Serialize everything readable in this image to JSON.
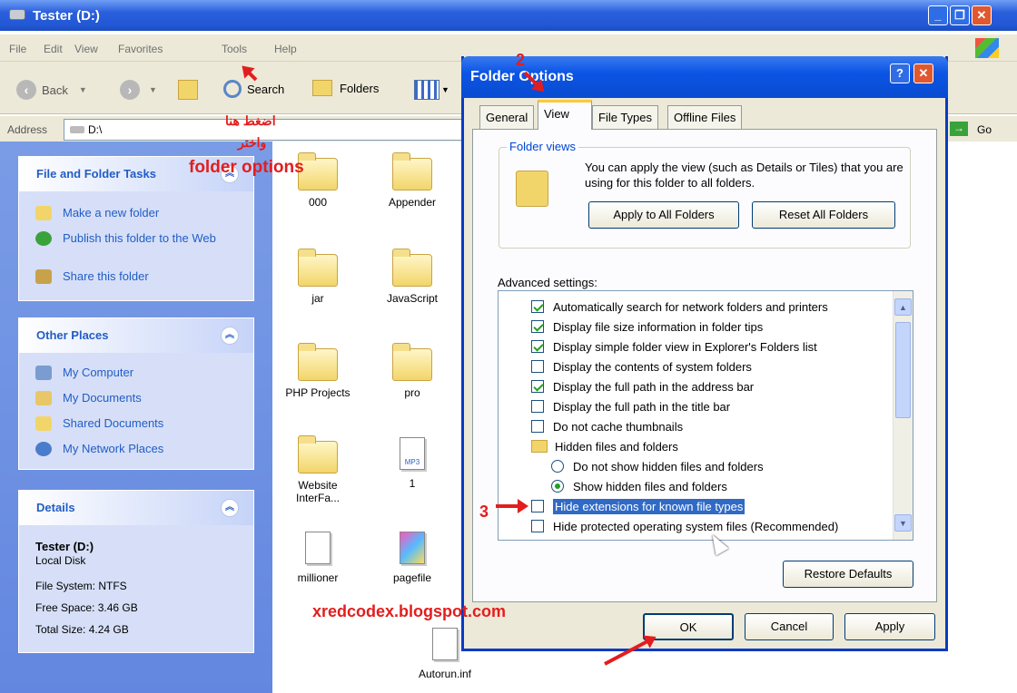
{
  "window": {
    "title": "Tester (D:)"
  },
  "menu": [
    "File",
    "Edit",
    "View",
    "Favorites",
    "Tools",
    "Help"
  ],
  "toolbar": {
    "back": "Back",
    "search": "Search",
    "folders": "Folders"
  },
  "address": {
    "label": "Address",
    "value": "D:\\",
    "go": "Go"
  },
  "tasks": {
    "title": "File and Folder Tasks",
    "items": [
      "Make a new folder",
      "Publish this folder to the Web",
      "Share this folder"
    ]
  },
  "places": {
    "title": "Other Places",
    "items": [
      "My Computer",
      "My Documents",
      "Shared Documents",
      "My Network Places"
    ]
  },
  "details": {
    "title": "Details",
    "name": "Tester (D:)",
    "type": "Local Disk",
    "fs": "File System: NTFS",
    "free": "Free Space: 3.46 GB",
    "total": "Total Size: 4.24 GB"
  },
  "files": [
    "000",
    "Appender",
    "jar",
    "JavaScript",
    "PHP Projects",
    "pro",
    "Website InterFa...",
    "1",
    "millioner",
    "pagefile",
    "Autorun.inf"
  ],
  "dialog": {
    "title": "Folder Options",
    "tabs": [
      "General",
      "View",
      "File Types",
      "Offline Files"
    ],
    "group_title": "Folder views",
    "group_text": "You can apply the view (such as Details or Tiles) that you are using for this folder to all folders.",
    "apply_all": "Apply to All Folders",
    "reset_all": "Reset All Folders",
    "advanced": "Advanced settings:",
    "settings": [
      {
        "label": "Automatically search for network folders and printers",
        "kind": "check",
        "on": true
      },
      {
        "label": "Display file size information in folder tips",
        "kind": "check",
        "on": true
      },
      {
        "label": "Display simple folder view in Explorer's Folders list",
        "kind": "check",
        "on": true
      },
      {
        "label": "Display the contents of system folders",
        "kind": "check",
        "on": false
      },
      {
        "label": "Display the full path in the address bar",
        "kind": "check",
        "on": true
      },
      {
        "label": "Display the full path in the title bar",
        "kind": "check",
        "on": false
      },
      {
        "label": "Do not cache thumbnails",
        "kind": "check",
        "on": false
      },
      {
        "label": "Hidden files and folders",
        "kind": "folder",
        "on": false
      },
      {
        "label": "Do not show hidden files and folders",
        "kind": "radio",
        "on": false
      },
      {
        "label": "Show hidden files and folders",
        "kind": "radio",
        "on": true
      },
      {
        "label": "Hide extensions for known file types",
        "kind": "check",
        "on": false,
        "selected": true
      },
      {
        "label": "Hide protected operating system files (Recommended)",
        "kind": "check",
        "on": false
      }
    ],
    "restore": "Restore Defaults",
    "ok": "OK",
    "cancel": "Cancel",
    "apply": "Apply"
  },
  "annotations": {
    "arabic1": "اضغط هنا",
    "arabic2": "واختر",
    "folder_options": "folder options",
    "n2": "2",
    "n3": "3",
    "site": "xredcodex.blogspot.com"
  },
  "colors": {
    "xp_blue": "#2258d6",
    "task_link": "#215dc6",
    "annotation_red": "#e31d1d",
    "selection": "#316ac5"
  }
}
